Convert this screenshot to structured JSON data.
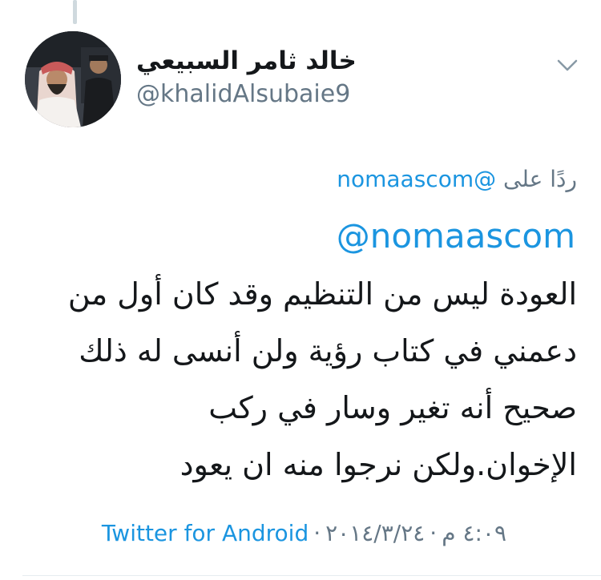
{
  "tweet": {
    "author": {
      "display_name": "خالد ثامر السبيعي",
      "handle": "@khalidAlsubaie9"
    },
    "menu_icon": "chevron-down-icon",
    "reply_label": "ردًا على",
    "reply_to_user": "@nomaascom",
    "mention": "@nomaascom",
    "body_lines": [
      "العودة ليس من التنظيم وقد كان أول من",
      "دعمني في كتاب رؤية ولن أنسى له ذلك",
      "صحيح أنه تغير وسار في ركب",
      "الإخوان.ولكن نرجوا منه ان يعود"
    ],
    "time": "٤:٠٩ م",
    "date": "٢٠١٤/٣/٢٤",
    "source": "Twitter for Android",
    "separator": "·"
  },
  "colors": {
    "link": "#1b95e0",
    "secondary": "#657786",
    "text": "#14171a",
    "thread_line": "#cfd9de"
  }
}
